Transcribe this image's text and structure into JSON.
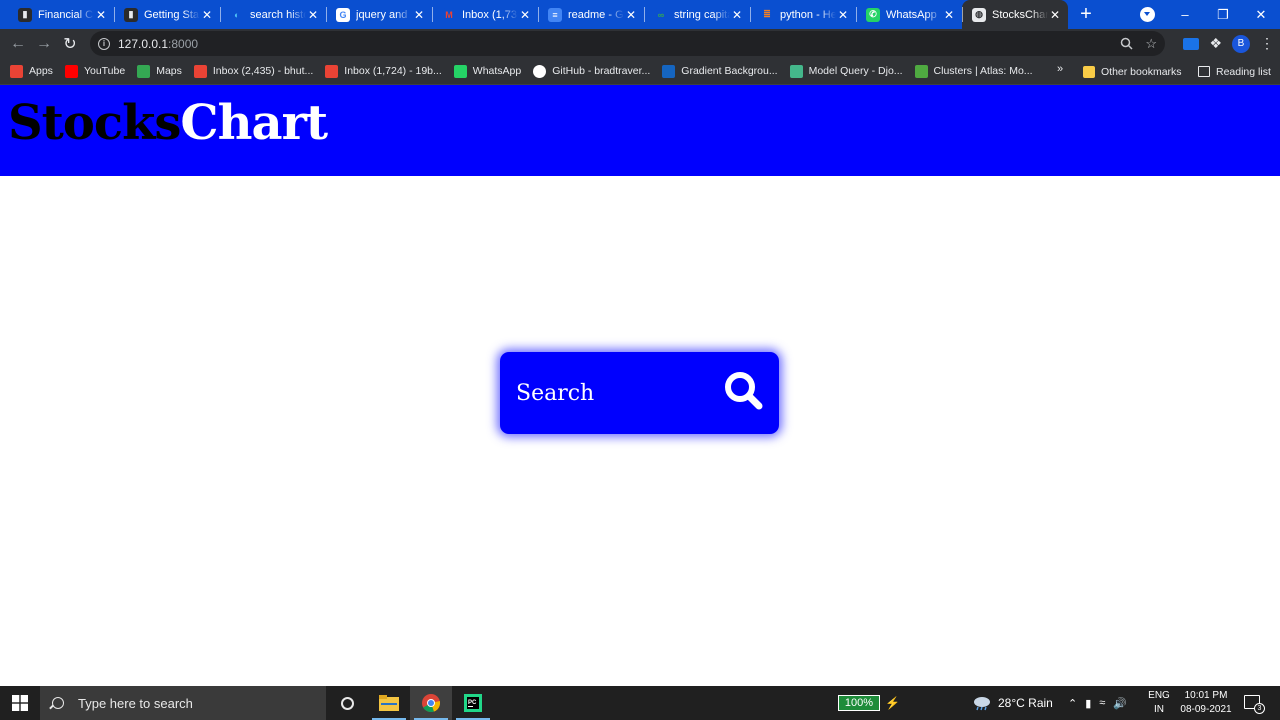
{
  "browser": {
    "tabs": [
      {
        "title": "Financial Ch",
        "icon": "bar-chart-icon",
        "active": false
      },
      {
        "title": "Getting Star",
        "icon": "bar-chart-icon",
        "active": false
      },
      {
        "title": "search histo",
        "icon": "edge-icon",
        "active": false
      },
      {
        "title": "jquery and",
        "icon": "google-icon",
        "active": false
      },
      {
        "title": "Inbox (1,73(",
        "icon": "gmail-icon",
        "active": false
      },
      {
        "title": "readme - Gi",
        "icon": "docs-icon",
        "active": false
      },
      {
        "title": "string capita",
        "icon": "link-icon",
        "active": false
      },
      {
        "title": "python - He",
        "icon": "stack-icon",
        "active": false
      },
      {
        "title": "WhatsApp",
        "icon": "whatsapp-icon",
        "active": false
      },
      {
        "title": "StocksChart",
        "icon": "globe-icon",
        "active": true
      }
    ],
    "tab_close": "✕",
    "new_tab": "+",
    "address": {
      "host": "127.0.0.1",
      "port": ":8000"
    },
    "profile_initial": "B",
    "bookmarks": [
      {
        "label": "Apps",
        "icon": "apps-grid-icon",
        "color": "#ea4335"
      },
      {
        "label": "YouTube",
        "icon": "youtube-icon",
        "color": "#ff0000"
      },
      {
        "label": "Maps",
        "icon": "maps-icon",
        "color": "#34a853"
      },
      {
        "label": "Inbox (2,435) - bhut...",
        "icon": "gmail-icon",
        "color": "#ea4335"
      },
      {
        "label": "Inbox (1,724) - 19b...",
        "icon": "gmail-icon",
        "color": "#ea4335"
      },
      {
        "label": "WhatsApp",
        "icon": "whatsapp-icon",
        "color": "#25d366"
      },
      {
        "label": "GitHub - bradtraver...",
        "icon": "github-icon",
        "color": "#ffffff"
      },
      {
        "label": "Gradient Backgrou...",
        "icon": "gradient-icon",
        "color": "#1565c0"
      },
      {
        "label": "Model Query - Djo...",
        "icon": "django-icon",
        "color": "#44b78b"
      },
      {
        "label": "Clusters | Atlas: Mo...",
        "icon": "mongodb-icon",
        "color": "#4faa41"
      }
    ],
    "bookmarks_more": "»",
    "other_bookmarks": "Other bookmarks",
    "reading_list": "Reading list"
  },
  "page": {
    "brand_part1": "Stocks",
    "brand_part2": "Chart",
    "search_label": "Search",
    "colors": {
      "header": "#0000fe",
      "brand_dark": "#000000",
      "brand_light": "#ffffff"
    }
  },
  "taskbar": {
    "search_placeholder": "Type here to search",
    "battery": "100%",
    "weather": "28°C  Rain",
    "lang_line1": "ENG",
    "lang_line2": "IN",
    "time": "10:01 PM",
    "date": "08-09-2021",
    "notification_count": "3"
  }
}
